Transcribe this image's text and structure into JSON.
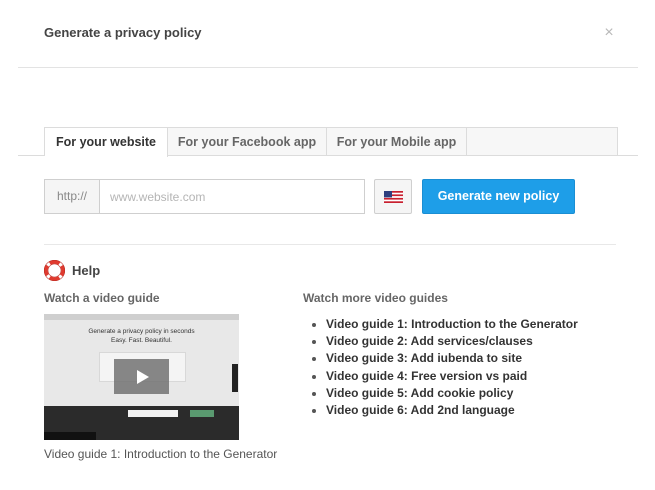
{
  "modal": {
    "title": "Generate a privacy policy",
    "close_glyph": "×"
  },
  "tabs": [
    {
      "label": "For your website",
      "active": true
    },
    {
      "label": "For your Facebook app",
      "active": false
    },
    {
      "label": "For your Mobile app",
      "active": false
    }
  ],
  "url_form": {
    "prefix": "http://",
    "placeholder": "www.website.com",
    "value": "",
    "language_icon": "us-flag-icon"
  },
  "generate_button": {
    "label": "Generate new policy",
    "color": "#1e9ee8"
  },
  "help": {
    "icon": "lifebuoy-icon",
    "title": "Help",
    "video_heading": "Watch a video guide",
    "video": {
      "thumbnail_line1": "Generate a privacy policy in seconds",
      "thumbnail_line2": "Easy. Fast. Beautiful.",
      "caption": "Video guide 1: Introduction to the Generator"
    },
    "more_heading": "Watch more video guides",
    "guides": [
      "Video guide 1: Introduction to the Generator",
      "Video guide 2: Add services/clauses",
      "Video guide 3: Add iubenda to site",
      "Video guide 4: Free version vs paid",
      "Video guide 5: Add cookie policy",
      "Video guide 6: Add 2nd language"
    ]
  }
}
